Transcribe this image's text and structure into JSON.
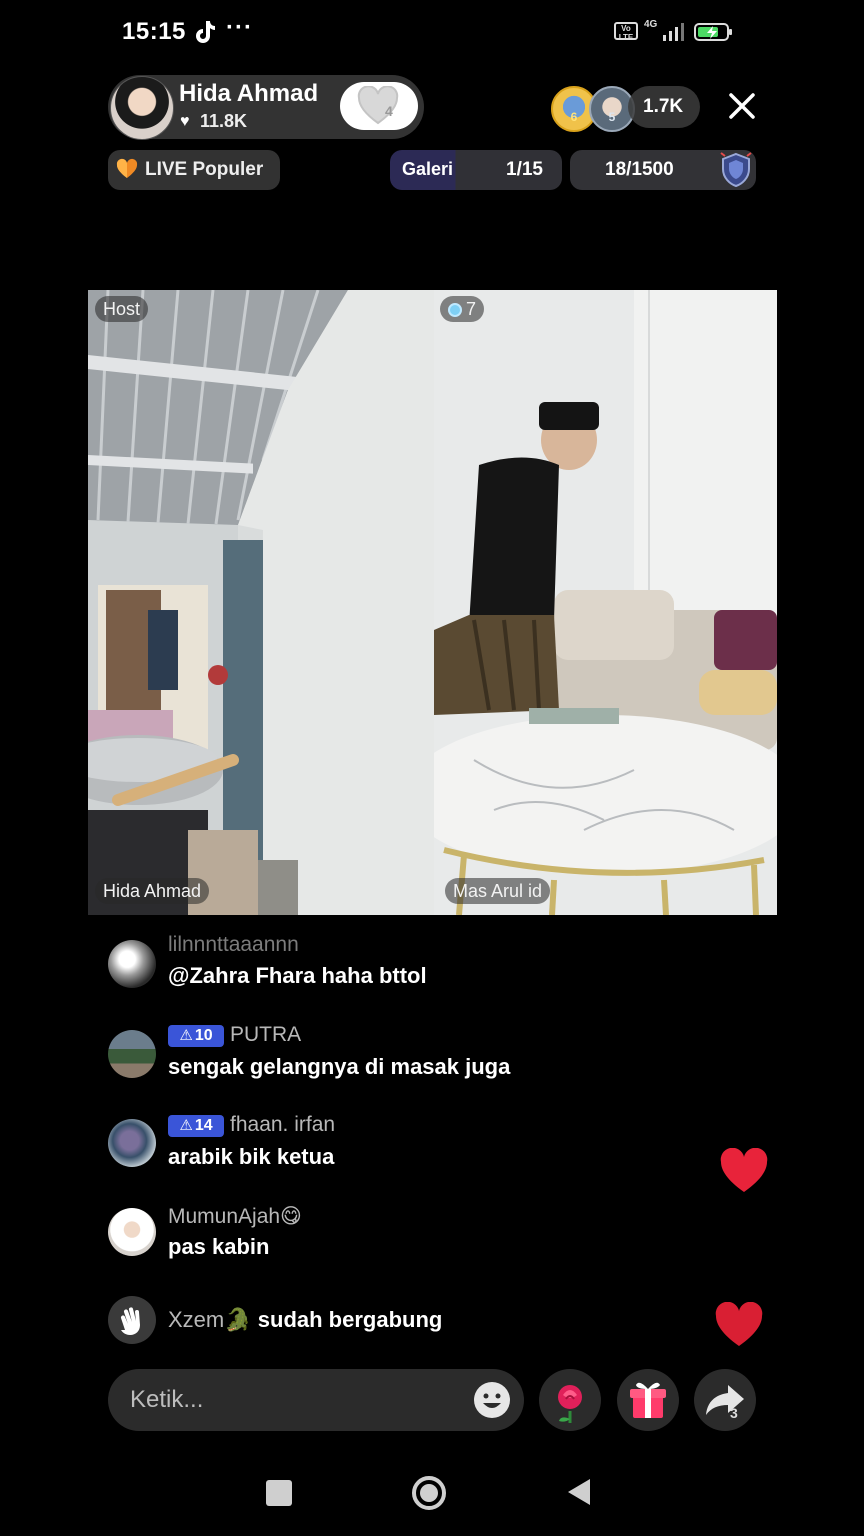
{
  "status_bar": {
    "time": "15:15",
    "network": "4G",
    "volte": "Vo LTE",
    "more": "···"
  },
  "host": {
    "name": "Hida Ahmad",
    "likes": "11.8K",
    "follow_count": "4"
  },
  "viewers": {
    "count": "1.7K",
    "rank_badges": [
      "6",
      "5"
    ]
  },
  "badges": {
    "popular_label": "LIVE Populer",
    "gallery_label": "Galeri",
    "gallery_count": "1/15",
    "rank_count": "18/1500"
  },
  "video": {
    "host_tag": "Host",
    "guest_score": "7",
    "left_name": "Hida Ahmad",
    "right_name": "Mas Arul id"
  },
  "comments": [
    {
      "user": "lilnnnttaaannn",
      "level": "",
      "text": "@Zahra Fhara haha bttol"
    },
    {
      "user": "PUTRA",
      "level": "10",
      "text": "sengak gelangnya di masak juga"
    },
    {
      "user": "fhaan. irfan",
      "level": "14",
      "text": "arabik bik ketua"
    },
    {
      "user": "MumunAjah😋",
      "level": "",
      "text": "pas kabin"
    }
  ],
  "join_notice": {
    "user": "Xzem🐊",
    "text": "sudah bergabung"
  },
  "input": {
    "placeholder": "Ketik..."
  },
  "share_count": "3",
  "colors": {
    "accent_heart": "#e8233a",
    "level_badge": "#3a55d8",
    "popular_icon": "#f08a24"
  }
}
